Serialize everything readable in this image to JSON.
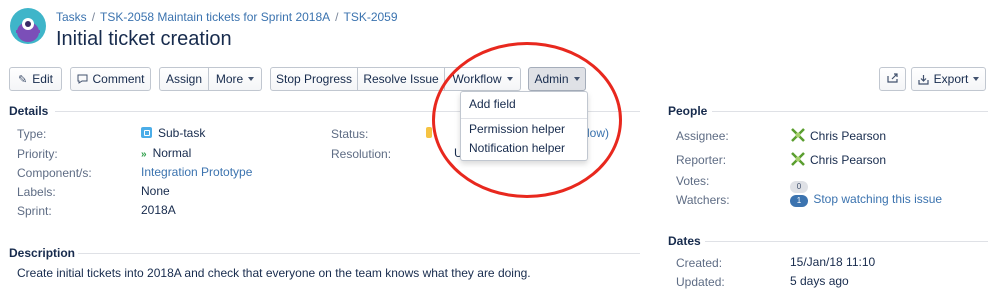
{
  "breadcrumb": {
    "items": [
      "Tasks",
      "TSK-2058 Maintain tickets for Sprint 2018A",
      "TSK-2059"
    ],
    "separator": "/"
  },
  "issue": {
    "title": "Initial ticket creation"
  },
  "toolbar": {
    "edit": "Edit",
    "comment": "Comment",
    "assign": "Assign",
    "more": "More",
    "stop_progress": "Stop Progress",
    "resolve_issue": "Resolve Issue",
    "workflow": "Workflow",
    "admin": "Admin",
    "share_icon": "share-icon",
    "export": "Export"
  },
  "admin_menu": {
    "items": [
      "Add field",
      "Permission helper",
      "Notification helper"
    ]
  },
  "details": {
    "title": "Details",
    "type": {
      "label": "Type:",
      "value": "Sub-task"
    },
    "priority": {
      "label": "Priority:",
      "value": "Normal"
    },
    "components": {
      "label": "Component/s:",
      "value": "Integration Prototype"
    },
    "labels": {
      "label": "Labels:",
      "value": "None"
    },
    "sprint": {
      "label": "Sprint:",
      "value": "2018A"
    },
    "status": {
      "label": "Status:",
      "value_fragment": "low)"
    },
    "resolution": {
      "label": "Resolution:",
      "value_fragment": "U"
    }
  },
  "description": {
    "title": "Description",
    "text": "Create initial tickets into 2018A and check that everyone on the team knows what they are doing."
  },
  "people": {
    "title": "People",
    "assignee": {
      "label": "Assignee:",
      "value": "Chris Pearson"
    },
    "reporter": {
      "label": "Reporter:",
      "value": "Chris Pearson"
    },
    "votes": {
      "label": "Votes:",
      "count": "0"
    },
    "watchers": {
      "label": "Watchers:",
      "count": "1",
      "action": "Stop watching this issue"
    }
  },
  "dates": {
    "title": "Dates",
    "created": {
      "label": "Created:",
      "value": "15/Jan/18 11:10"
    },
    "updated": {
      "label": "Updated:",
      "value": "5 days ago"
    }
  },
  "colors": {
    "link": "#3b73af",
    "annotation": "#e8281e",
    "avatar": "#3fb5c9"
  }
}
